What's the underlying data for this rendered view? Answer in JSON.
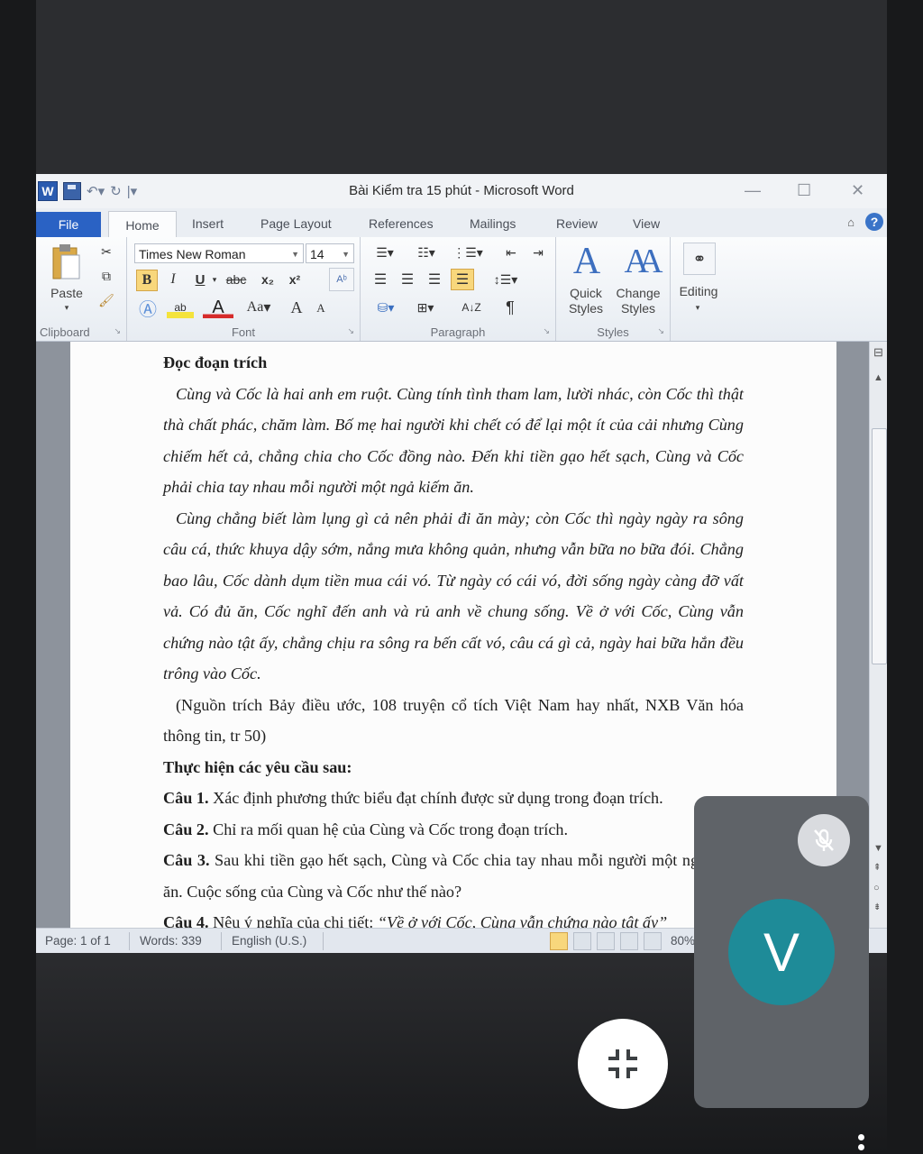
{
  "window": {
    "title": "Bài Kiểm tra 15 phút  -  Microsoft Word",
    "app_icon": "W"
  },
  "ribbon_tabs": [
    "File",
    "Home",
    "Insert",
    "Page Layout",
    "References",
    "Mailings",
    "Review",
    "View"
  ],
  "ribbon": {
    "clipboard": {
      "paste_label": "Paste",
      "group_label": "Clipboard"
    },
    "font": {
      "font_name": "Times New Roman",
      "font_size": "14",
      "bold": "B",
      "italic": "I",
      "underline": "U",
      "strike": "abc",
      "subscript": "x₂",
      "superscript": "x²",
      "change_case": "Aa",
      "grow": "A",
      "shrink": "A",
      "group_label": "Font"
    },
    "paragraph": {
      "group_label": "Paragraph"
    },
    "styles": {
      "quick_styles": "Quick Styles",
      "change_styles": "Change Styles",
      "group_label": "Styles"
    },
    "editing": {
      "label": "Editing"
    }
  },
  "document": {
    "heading": "Đọc đoạn trích",
    "para1": "Cùng và Cốc là hai anh em ruột. Cùng tính tình tham lam, lười nhác, còn Cốc thì thật thà chất phác, chăm làm. Bố mẹ hai người khi chết có để lại một ít của cải nhưng Cùng chiếm hết cả, chẳng chia cho Cốc đồng nào. Đến khi tiền gạo hết sạch, Cùng và Cốc phải chia tay nhau mỗi người một ngả kiếm ăn.",
    "para2": "Cùng chẳng biết làm lụng gì cả nên phải đi ăn mày; còn Cốc thì ngày ngày ra sông câu cá, thức khuya dậy sớm, nắng mưa không quản, nhưng vẫn bữa no bữa đói. Chẳng bao lâu, Cốc dành dụm tiền mua cái vó. Từ ngày có cái vó, đời sống ngày càng đỡ vất vả. Có đủ ăn, Cốc nghĩ đến anh và rủ anh về chung sống. Về ở với Cốc, Cùng vẫn chứng nào tật ấy, chẳng chịu ra sông ra bến cất vó, câu cá gì cả, ngày hai bữa hắn đều trông vào Cốc.",
    "source": "(Nguồn trích Bảy điều ước, 108 truyện cổ tích Việt Nam hay nhất, NXB Văn hóa thông tin, tr 50)",
    "task_heading": "Thực hiện các yêu cầu sau:",
    "q1_label": "Câu 1.",
    "q1_text": " Xác định phương thức biểu đạt chính được sử dụng trong đoạn trích.",
    "q2_label": "Câu 2.",
    "q2_text": " Chỉ ra mối quan hệ của Cùng và Cốc trong đoạn trích.",
    "q3_label": "Câu 3.",
    "q3_text": " Sau khi tiền gạo hết sạch, Cùng và Cốc chia tay nhau mỗi người một ngả kiếm ăn. Cuộc sống của Cùng và Cốc như thế nào?",
    "q4_label": "Câu 4.",
    "q4_text": " Nêu ý nghĩa của chi tiết: ",
    "q4_quote": "“Về ở với Cốc, Cùng vẫn chứng nào tật ấy”"
  },
  "statusbar": {
    "page": "Page: 1 of 1",
    "words": "Words: 339",
    "language": "English (U.S.)",
    "zoom": "80%"
  },
  "call": {
    "participant_initial": "V",
    "avatar_color": "#1e8b98",
    "mic_state": "muted"
  }
}
